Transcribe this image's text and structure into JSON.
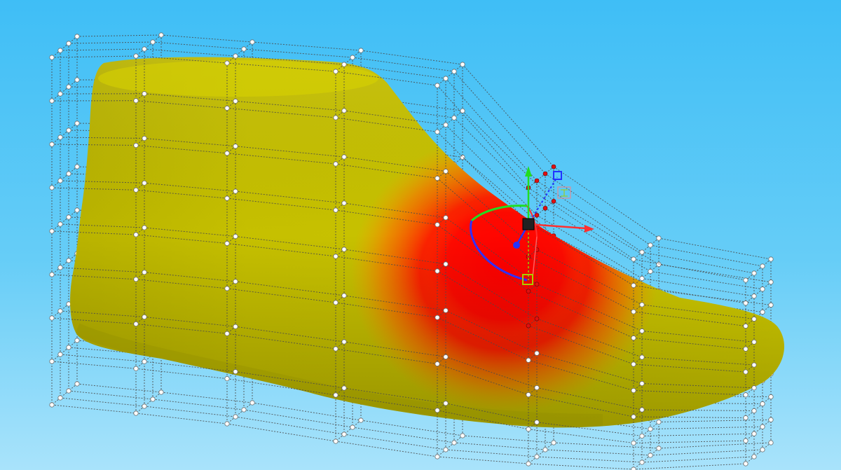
{
  "viewport": {
    "background_top": "#3fbef6",
    "background_bottom": "#a9e3fb"
  },
  "model": {
    "object": "shoe-last",
    "surface_color": "#c9c400",
    "highlight_color": "#ff1a00"
  },
  "deformation_cage": {
    "line_color": "#4a4a4a",
    "point_color": "#ffffff",
    "selected_point_color": "#e01010"
  },
  "gizmo": {
    "x_axis_color": "#ff3030",
    "y_axis_color": "#22dd22",
    "z_axis_color": "#2233ff",
    "pivot_color": "#222222"
  },
  "icons": [
    "move-gizmo-icon",
    "rotate-gizmo-icon",
    "scale-handle-icon"
  ]
}
